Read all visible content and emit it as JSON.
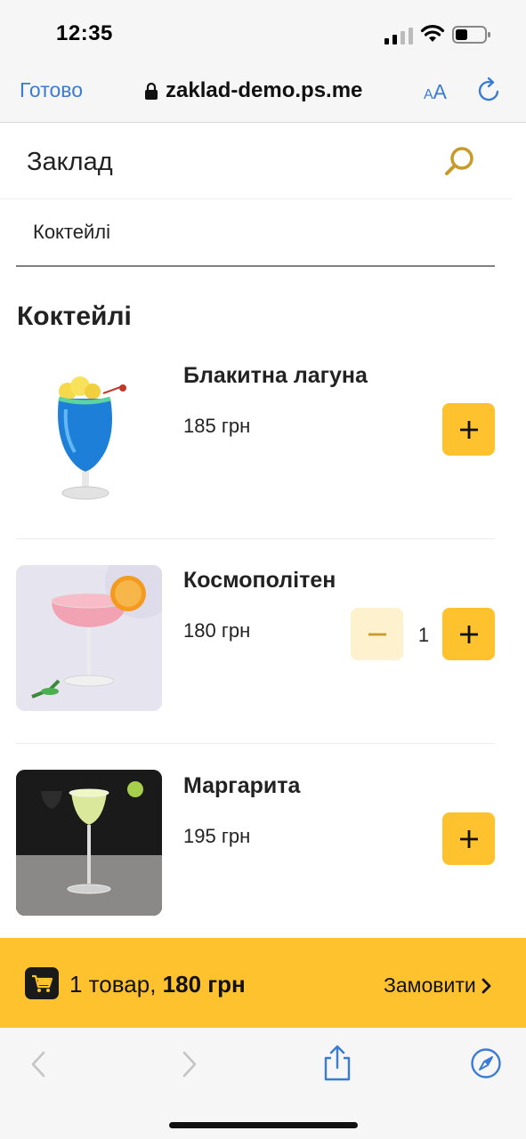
{
  "status_bar": {
    "time": "12:35"
  },
  "browser": {
    "done_label": "Готово",
    "url": "zaklad-demo.ps.me",
    "text_size_label_small": "A",
    "text_size_label_large": "A"
  },
  "site": {
    "name": "Заклад"
  },
  "category_tab": "Коктейлі",
  "section_title": "Коктейлі",
  "products": [
    {
      "name": "Блакитна лагуна",
      "price": "185 грн",
      "quantity": null
    },
    {
      "name": "Космополітен",
      "price": "180 грн",
      "quantity": "1"
    },
    {
      "name": "Маргарита",
      "price": "195 грн",
      "quantity": null
    }
  ],
  "cart": {
    "count_text": "1 товар,",
    "total_text": "180 грн",
    "order_label": "Замовити"
  },
  "colors": {
    "accent": "#fdc22e",
    "accent_light": "#fef1ce",
    "link_blue": "#3a7bd5",
    "search_icon": "#c89a2a"
  }
}
